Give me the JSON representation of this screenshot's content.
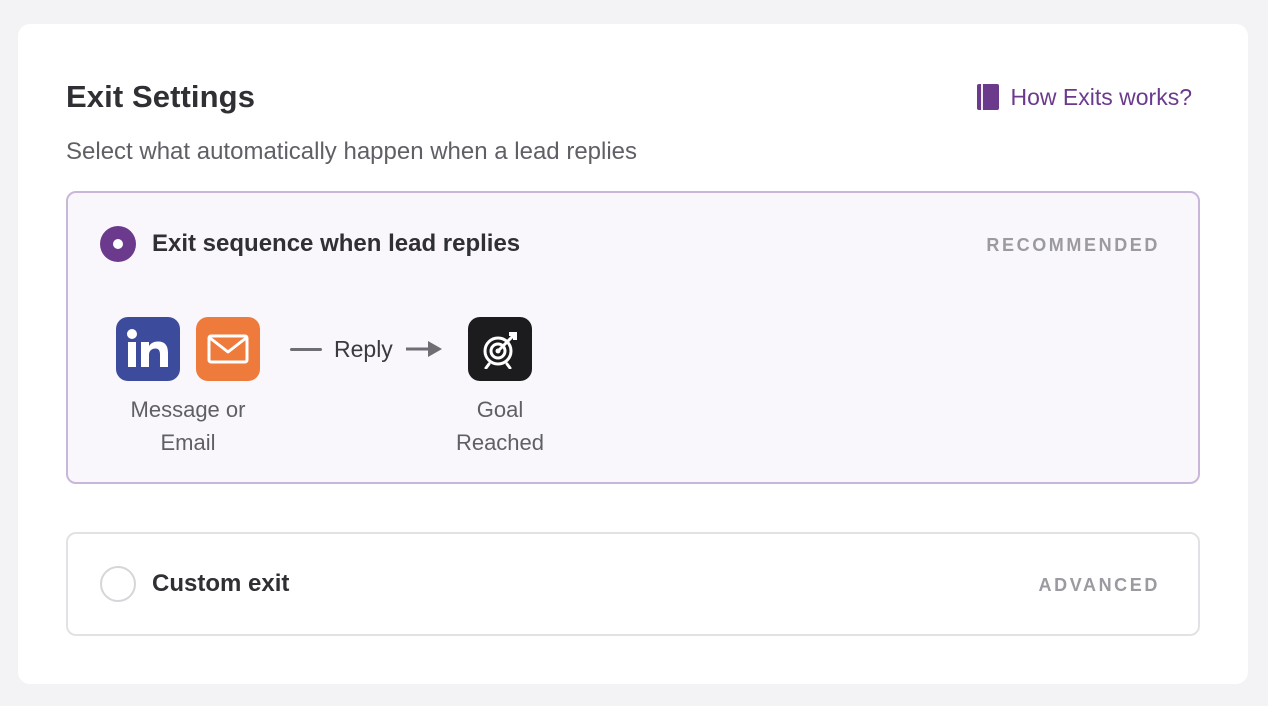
{
  "header": {
    "title": "Exit Settings",
    "help_link": "How Exits works?",
    "subtitle": "Select what automatically happen when a lead replies"
  },
  "options": [
    {
      "label": "Exit sequence when lead replies",
      "tag": "RECOMMENDED",
      "selected": true
    },
    {
      "label": "Custom exit",
      "tag": "ADVANCED",
      "selected": false
    }
  ],
  "flow": {
    "source_line1": "Message or",
    "source_line2": "Email",
    "connector": "Reply",
    "target_line1": "Goal",
    "target_line2": "Reached",
    "icons": [
      "linkedin-icon",
      "mail-icon",
      "target-icon"
    ]
  },
  "colors": {
    "accent": "#6b3a8c",
    "linkedin": "#3d4b9c",
    "email": "#ee7a3b",
    "goal": "#1c1c1f"
  }
}
